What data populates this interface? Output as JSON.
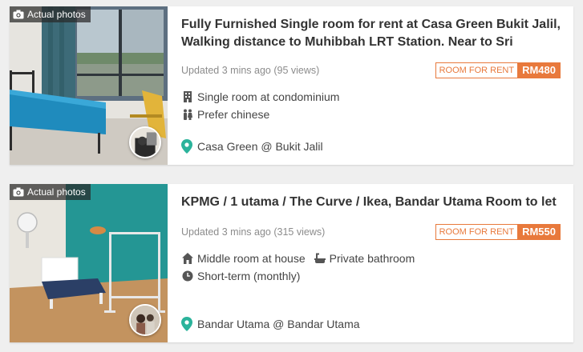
{
  "listings": [
    {
      "badge": "Actual photos",
      "title": "Fully Furnished Single room for rent at Casa Green Bukit Jalil, Walking distance to Muhibbah LRT Station. Near to Sri",
      "updated": "Updated 3 mins ago (95 views)",
      "price_type": "ROOM FOR RENT",
      "price": "RM480",
      "features": [
        "Single room at condominium",
        "Prefer chinese"
      ],
      "location": "Casa Green @ Bukit Jalil"
    },
    {
      "badge": "Actual photos",
      "title": "KPMG / 1 utama / The Curve / Ikea, Bandar Utama Room to let",
      "updated": "Updated 3 mins ago (315 views)",
      "price_type": "ROOM FOR RENT",
      "price": "RM550",
      "features": [
        "Middle room at house",
        "Private bathroom",
        "Short-term (monthly)"
      ],
      "location": "Bandar Utama @ Bandar Utama"
    }
  ],
  "colors": {
    "accent": "#e8793c",
    "pin": "#2bb39b",
    "background": "#efefef"
  },
  "icons": {
    "badge": "camera-icon",
    "features_1": [
      "building-icon",
      "people-icon"
    ],
    "features_2": [
      "house-icon",
      "bathtub-icon",
      "clock-icon"
    ],
    "location": "map-pin-icon"
  }
}
